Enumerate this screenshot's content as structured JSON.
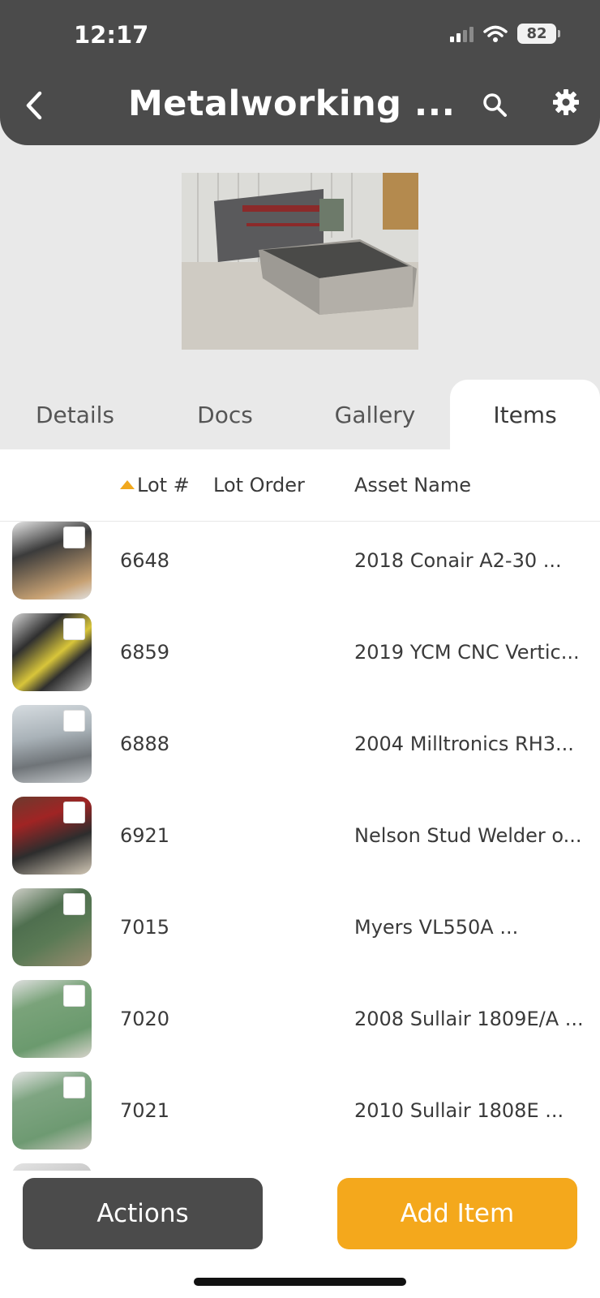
{
  "status_bar": {
    "time": "12:17",
    "battery": "82"
  },
  "header": {
    "title": "Metalworking ..."
  },
  "tabs": [
    {
      "label": "Details"
    },
    {
      "label": "Docs"
    },
    {
      "label": "Gallery"
    },
    {
      "label": "Items",
      "active": true
    }
  ],
  "table": {
    "columns": {
      "lot": "Lot #",
      "lot_order": "Lot Order",
      "asset_name": "Asset Name"
    },
    "sort": {
      "column": "lot",
      "direction": "ascending"
    },
    "rows": [
      {
        "lot": "6648",
        "asset": "2018 Conair A2-30 ..."
      },
      {
        "lot": "6859",
        "asset": "2019 YCM CNC Vertic..."
      },
      {
        "lot": "6888",
        "asset": "2004 Milltronics RH3..."
      },
      {
        "lot": "6921",
        "asset": "Nelson Stud Welder o..."
      },
      {
        "lot": "7015",
        "asset": "Myers VL550A ..."
      },
      {
        "lot": "7020",
        "asset": "2008 Sullair 1809E/A ..."
      },
      {
        "lot": "7021",
        "asset": "2010 Sullair 1808E ..."
      }
    ]
  },
  "footer": {
    "actions_label": "Actions",
    "add_item_label": "Add Item"
  },
  "colors": {
    "header_bg": "#4b4b4b",
    "accent": "#f4a81c",
    "page_bg": "#e9e9e9"
  }
}
